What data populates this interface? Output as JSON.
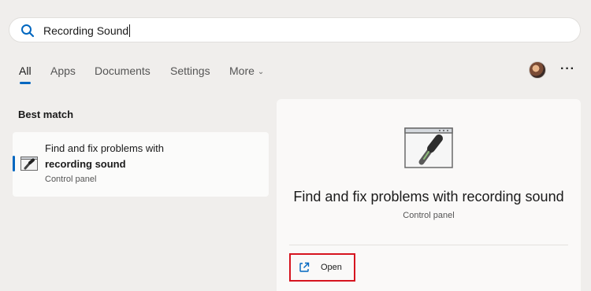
{
  "search": {
    "value": "Recording Sound"
  },
  "tabs": [
    {
      "label": "All"
    },
    {
      "label": "Apps"
    },
    {
      "label": "Documents"
    },
    {
      "label": "Settings"
    },
    {
      "label": "More"
    }
  ],
  "colors": {
    "accent": "#0067c0",
    "highlight_border": "#d6141f"
  },
  "best_match": {
    "heading": "Best match",
    "result": {
      "title_line1": "Find and fix problems with",
      "title_line2": "recording sound",
      "subtitle": "Control panel",
      "icon": "microphone-window-icon"
    }
  },
  "detail": {
    "title": "Find and fix problems with recording sound",
    "subtitle": "Control panel",
    "icon": "microphone-window-icon",
    "open_label": "Open",
    "open_icon": "external-link-icon"
  }
}
